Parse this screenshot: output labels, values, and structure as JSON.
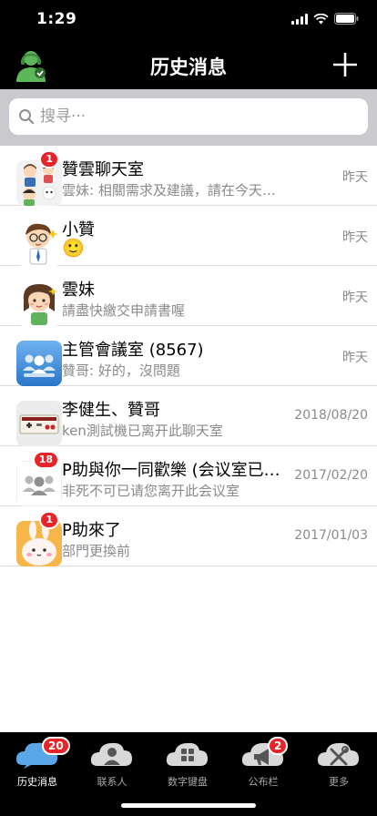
{
  "status_bar": {
    "time": "1:29"
  },
  "nav": {
    "title": "历史消息",
    "left_icon": "user-support-icon",
    "right_icon": "plus-icon"
  },
  "search": {
    "placeholder": "搜寻···",
    "value": ""
  },
  "chats": [
    {
      "name": "贊雲聊天室",
      "preview": "雲妹: 相關需求及建議，請在今天…",
      "time": "昨天",
      "badge": "1",
      "avatar": "group-cartoon-avatar"
    },
    {
      "name": "小贊",
      "preview": "🙂",
      "time": "昨天",
      "badge": "",
      "avatar": "boy-cartoon-avatar"
    },
    {
      "name": "雲妹",
      "preview": "請盡快繳交申請書喔",
      "time": "昨天",
      "badge": "",
      "avatar": "girl-cartoon-avatar"
    },
    {
      "name": "主管會議室 (8567)",
      "preview": "贊哥: 好的，沒問題",
      "time": "昨天",
      "badge": "",
      "avatar": "meeting-room-avatar"
    },
    {
      "name": "李健生、贊哥",
      "preview": "ken測試機已离开此聊天室",
      "time": "2018/08/20",
      "badge": "",
      "avatar": "game-controller-avatar"
    },
    {
      "name": "P助與你一同歡樂 (会议室已…",
      "preview": "非死不可已请您离开此会议室",
      "time": "2017/02/20",
      "badge": "18",
      "avatar": "group-gray-avatar"
    },
    {
      "name": "P助來了",
      "preview": "部門更換前",
      "time": "2017/01/03",
      "badge": "1",
      "avatar": "bunny-cartoon-avatar"
    }
  ],
  "tabs": [
    {
      "label": "历史消息",
      "icon": "chat-cloud-icon",
      "badge": "20",
      "active": true
    },
    {
      "label": "联系人",
      "icon": "contacts-cloud-icon",
      "badge": "",
      "active": false
    },
    {
      "label": "数字键盘",
      "icon": "keypad-cloud-icon",
      "badge": "",
      "active": false
    },
    {
      "label": "公布栏",
      "icon": "megaphone-cloud-icon",
      "badge": "2",
      "active": false
    },
    {
      "label": "更多",
      "icon": "tools-cloud-icon",
      "badge": "",
      "active": false
    }
  ],
  "colors": {
    "bar": "#000000",
    "badge": "#e8242b",
    "search_bg": "#c9c9ce",
    "active_tab": "#5aa7e8"
  }
}
